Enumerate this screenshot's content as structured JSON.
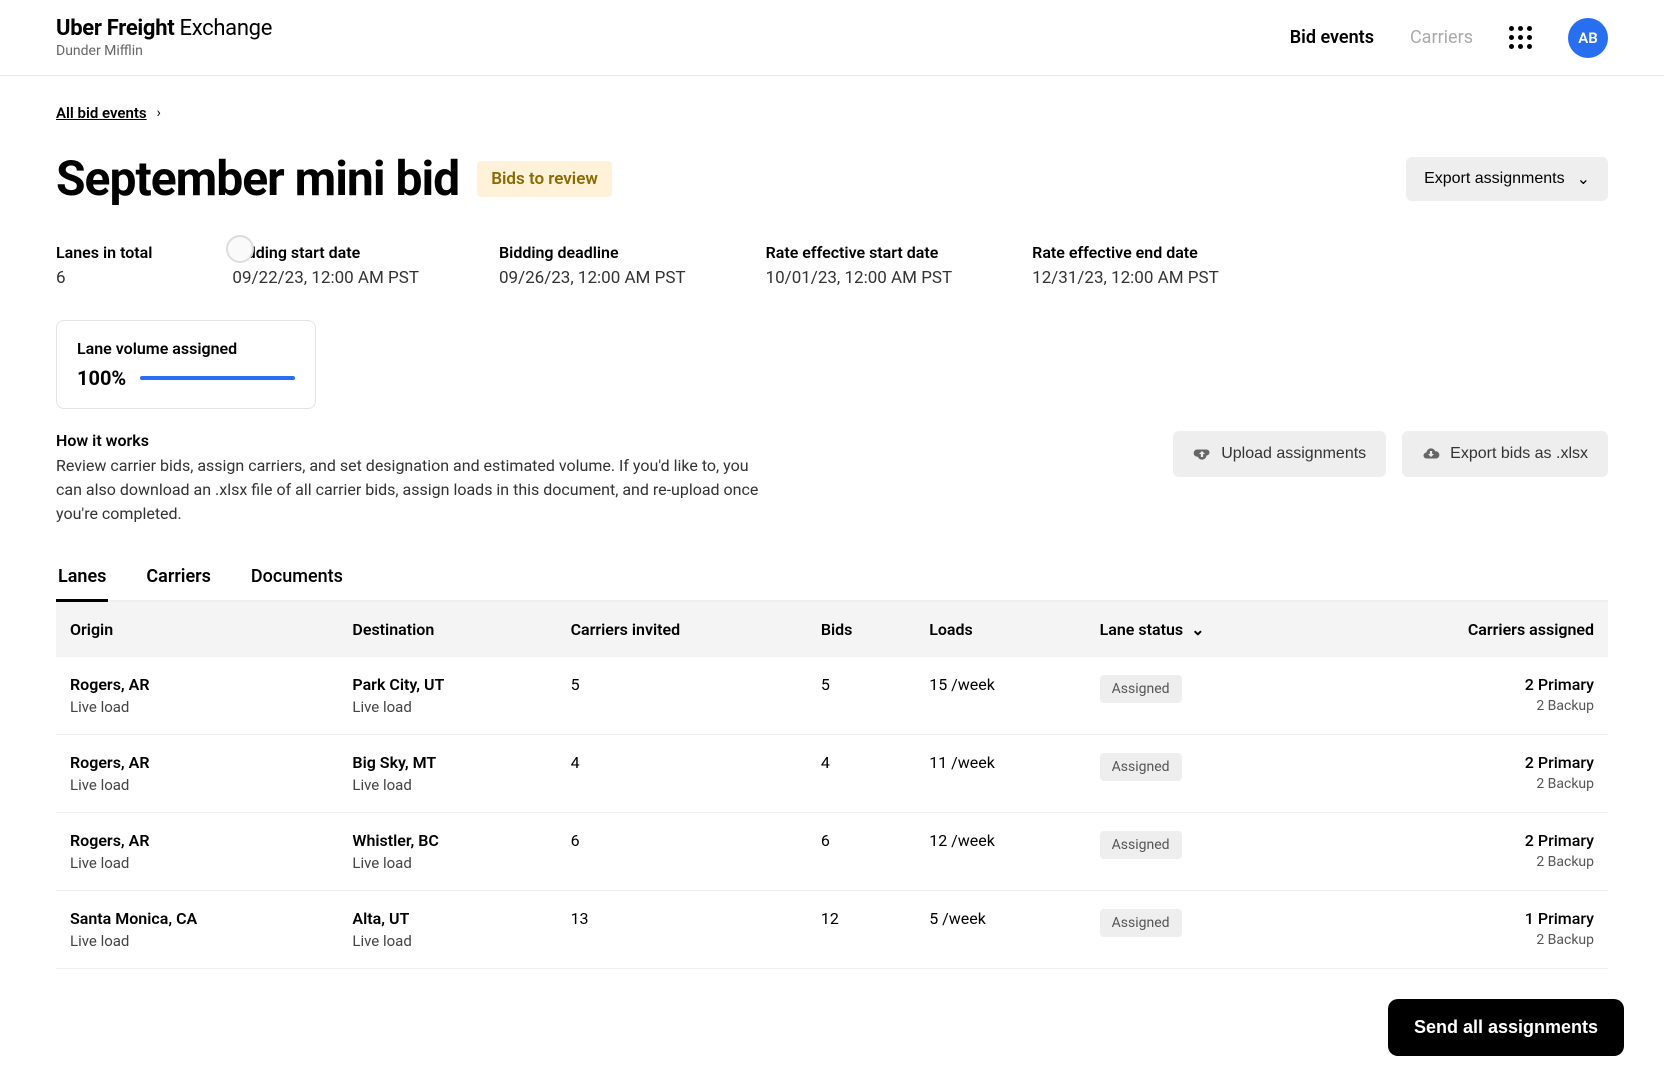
{
  "header": {
    "logo_bold": "Uber Freight",
    "logo_light": " Exchange",
    "logo_sub": "Dunder Mifflin",
    "nav": {
      "bid_events": "Bid events",
      "carriers": "Carriers"
    },
    "avatar": "AB"
  },
  "breadcrumb": {
    "all": "All bid events"
  },
  "title": "September mini bid",
  "status": "Bids to review",
  "export_assignments": "Export assignments",
  "meta": {
    "lanes_total": {
      "label": "Lanes in total",
      "value": "6"
    },
    "bid_start": {
      "label": "Bidding start date",
      "value": "09/22/23, 12:00 AM PST"
    },
    "bid_deadline": {
      "label": "Bidding deadline",
      "value": "09/26/23, 12:00 AM PST"
    },
    "rate_start": {
      "label": "Rate effective start date",
      "value": "10/01/23, 12:00 AM PST"
    },
    "rate_end": {
      "label": "Rate effective end date",
      "value": "12/31/23, 12:00 AM PST"
    }
  },
  "volume": {
    "label": "Lane volume assigned",
    "pct": "100%"
  },
  "howit": {
    "title": "How it works",
    "text": "Review carrier bids, assign carriers, and set designation and estimated volume. If you'd like to, you can also download an .xlsx file of all carrier bids, assign loads in  this document, and re-upload once you're completed."
  },
  "actions": {
    "upload": "Upload assignments",
    "export_bids": "Export bids as .xlsx"
  },
  "tabs": {
    "lanes": "Lanes",
    "carriers": "Carriers",
    "documents": "Documents"
  },
  "columns": {
    "origin": "Origin",
    "destination": "Destination",
    "invited": "Carriers invited",
    "bids": "Bids",
    "loads": "Loads",
    "status": "Lane status",
    "assigned": "Carriers assigned"
  },
  "rows": [
    {
      "origin": "Rogers, AR",
      "origin_sub": "Live load",
      "dest": "Park City, UT",
      "dest_sub": "Live load",
      "invited": "5",
      "bids": "5",
      "loads": "15 /week",
      "status": "Assigned",
      "assigned_primary": "2 Primary",
      "assigned_backup": "2 Backup"
    },
    {
      "origin": "Rogers, AR",
      "origin_sub": "Live load",
      "dest": "Big Sky, MT",
      "dest_sub": "Live load",
      "invited": "4",
      "bids": "4",
      "loads": "11 /week",
      "status": "Assigned",
      "assigned_primary": "2 Primary",
      "assigned_backup": "2 Backup"
    },
    {
      "origin": "Rogers, AR",
      "origin_sub": "Live load",
      "dest": "Whistler, BC",
      "dest_sub": "Live load",
      "invited": "6",
      "bids": "6",
      "loads": "12 /week",
      "status": "Assigned",
      "assigned_primary": "2 Primary",
      "assigned_backup": "2 Backup"
    },
    {
      "origin": "Santa Monica, CA",
      "origin_sub": "Live load",
      "dest": "Alta, UT",
      "dest_sub": "Live load",
      "invited": "13",
      "bids": "12",
      "loads": "5 /week",
      "status": "Assigned",
      "assigned_primary": "1 Primary",
      "assigned_backup": "2 Backup"
    }
  ],
  "send_all": "Send all assignments"
}
